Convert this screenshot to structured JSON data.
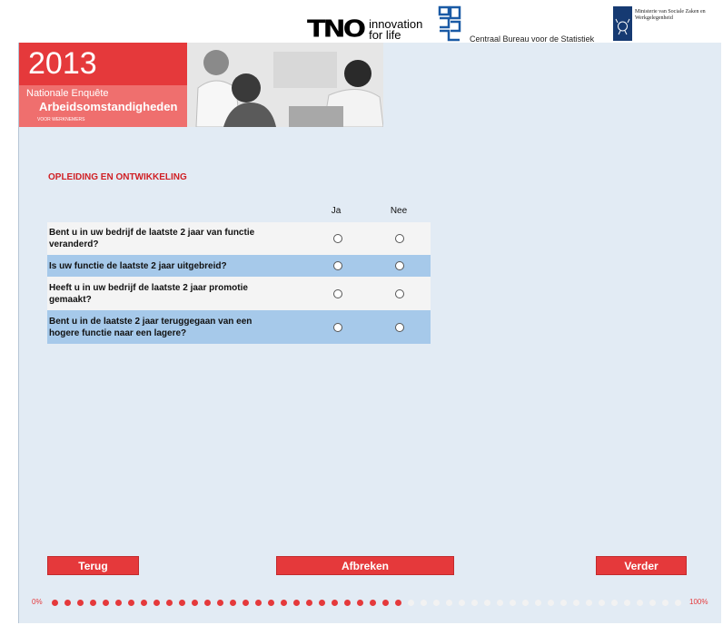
{
  "header": {
    "tno_mark": "TNO",
    "tno_tagline_1": "innovation",
    "tno_tagline_2": "for life",
    "cbs_name": "Centraal Bureau voor de Statistiek",
    "ministry_name": "Ministerie van Sociale Zaken en Werkgelegenheid"
  },
  "banner": {
    "year": "2013",
    "line1": "Nationale Enquête",
    "line2": "Arbeidsomstandigheden",
    "line3": "VOOR WERKNEMERS"
  },
  "section": {
    "title": "OPLEIDING EN ONTWIKKELING"
  },
  "columns": {
    "ja": "Ja",
    "nee": "Nee"
  },
  "questions": [
    {
      "text": "Bent u in uw bedrijf de laatste 2 jaar van functie veranderd?"
    },
    {
      "text": "Is uw functie de laatste 2 jaar uitgebreid?"
    },
    {
      "text": "Heeft u in uw bedrijf de laatste 2 jaar promotie gemaakt?"
    },
    {
      "text": "Bent u in de laatste 2 jaar teruggegaan van een hogere functie naar een lagere?"
    }
  ],
  "buttons": {
    "back": "Terug",
    "cancel": "Afbreken",
    "next": "Verder"
  },
  "progress": {
    "start_label": "0%",
    "end_label": "100%",
    "fraction": 0.57,
    "color_done": "#e5393b",
    "color_todo": "#f2f2f2"
  }
}
